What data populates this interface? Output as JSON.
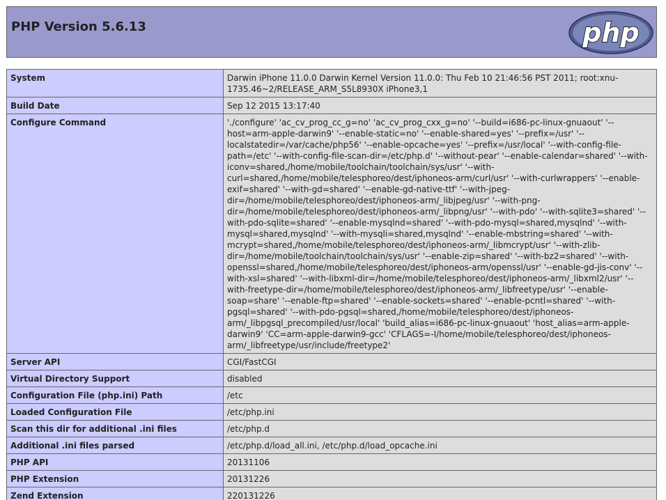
{
  "header": {
    "title": "PHP Version 5.6.13",
    "logo_text": "php"
  },
  "rows": [
    {
      "key": "System",
      "value": "Darwin iPhone 11.0.0 Darwin Kernel Version 11.0.0: Thu Feb 10 21:46:56 PST 2011; root:xnu-1735.46~2/RELEASE_ARM_S5L8930X iPhone3,1"
    },
    {
      "key": "Build Date",
      "value": "Sep 12 2015 13:17:40"
    },
    {
      "key": "Configure Command",
      "value": "'./configure' 'ac_cv_prog_cc_g=no' 'ac_cv_prog_cxx_g=no' '--build=i686-pc-linux-gnuaout' '--host=arm-apple-darwin9' '--enable-static=no' '--enable-shared=yes' '--prefix=/usr' '--localstatedir=/var/cache/php56' '--enable-opcache=yes' '--prefix=/usr/local' '--with-config-file-path=/etc' '--with-config-file-scan-dir=/etc/php.d' '--without-pear' '--enable-calendar=shared' '--with-iconv=shared,/home/mobile/toolchain/toolchain/sys/usr' '--with-curl=shared,/home/mobile/telesphoreo/dest/iphoneos-arm/curl/usr' '--with-curlwrappers' '--enable-exif=shared' '--with-gd=shared' '--enable-gd-native-ttf' '--with-jpeg-dir=/home/mobile/telesphoreo/dest/iphoneos-arm/_libjpeg/usr' '--with-png-dir=/home/mobile/telesphoreo/dest/iphoneos-arm/_libpng/usr' '--with-pdo' '--with-sqlite3=shared' '--with-pdo-sqlite=shared' '--enable-mysqlnd=shared' '--with-pdo-mysql=shared,mysqlnd' '--with-mysql=shared,mysqlnd' '--with-mysqli=shared,mysqlnd' '--enable-mbstring=shared' '--with-mcrypt=shared,/home/mobile/telesphoreo/dest/iphoneos-arm/_libmcrypt/usr' '--with-zlib-dir=/home/mobile/toolchain/toolchain/sys/usr' '--enable-zip=shared' '--with-bz2=shared' '--with-openssl=shared,/home/mobile/telesphoreo/dest/iphoneos-arm/openssl/usr' '--enable-gd-jis-conv' '--with-xsl=shared' '--with-libxml-dir=/home/mobile/telesphoreo/dest/iphoneos-arm/_libxml2/usr' '--with-freetype-dir=/home/mobile/telesphoreo/dest/iphoneos-arm/_libfreetype/usr' '--enable-soap=share' '--enable-ftp=shared' '--enable-sockets=shared' '--enable-pcntl=shared' '--with-pgsql=shared' '--with-pdo-pgsql=shared,/home/mobile/telesphoreo/dest/iphoneos-arm/_libpgsql_precompiled/usr/local' 'build_alias=i686-pc-linux-gnuaout' 'host_alias=arm-apple-darwin9' 'CC=arm-apple-darwin9-gcc' 'CFLAGS=-I/home/mobile/telesphoreo/dest/iphoneos-arm/_libfreetype/usr/include/freetype2'"
    },
    {
      "key": "Server API",
      "value": "CGI/FastCGI"
    },
    {
      "key": "Virtual Directory Support",
      "value": "disabled"
    },
    {
      "key": "Configuration File (php.ini) Path",
      "value": "/etc"
    },
    {
      "key": "Loaded Configuration File",
      "value": "/etc/php.ini"
    },
    {
      "key": "Scan this dir for additional .ini files",
      "value": "/etc/php.d"
    },
    {
      "key": "Additional .ini files parsed",
      "value": "/etc/php.d/load_all.ini, /etc/php.d/load_opcache.ini"
    },
    {
      "key": "PHP API",
      "value": "20131106"
    },
    {
      "key": "PHP Extension",
      "value": "20131226"
    },
    {
      "key": "Zend Extension",
      "value": "220131226"
    }
  ],
  "colors": {
    "header_bg": "#9999cc",
    "key_bg": "#ccccff",
    "value_bg": "#dddddd",
    "border": "#666666",
    "logo_bg": "#6c78ad"
  }
}
